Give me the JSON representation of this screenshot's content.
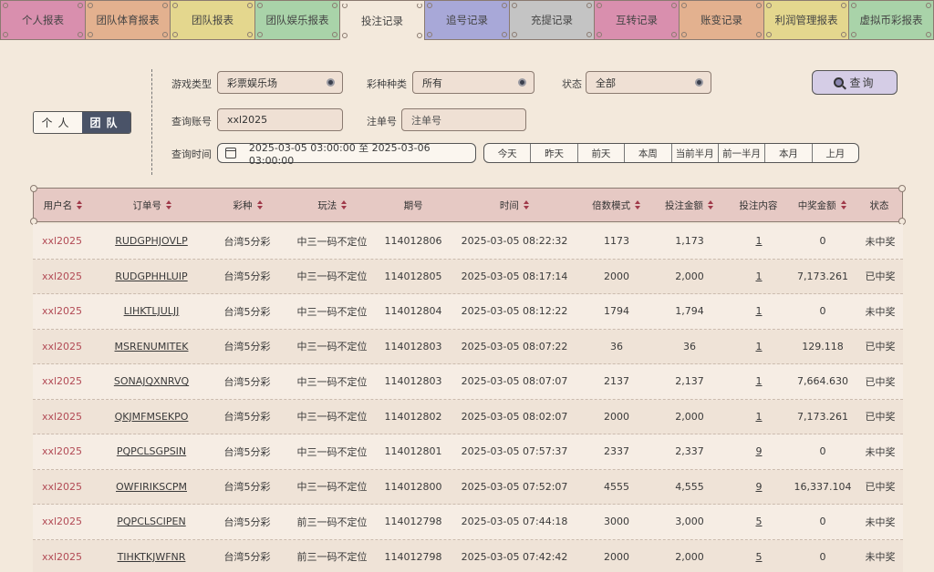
{
  "tabs": [
    {
      "label": "个人报表",
      "color": "#d98fae"
    },
    {
      "label": "团队体育报表",
      "color": "#e3b18f"
    },
    {
      "label": "团队报表",
      "color": "#e4d78e"
    },
    {
      "label": "团队娱乐报表",
      "color": "#a9d3a9"
    },
    {
      "label": "投注记录",
      "color": "#f3e9dc",
      "active": true
    },
    {
      "label": "追号记录",
      "color": "#a8a8d8"
    },
    {
      "label": "充提记录",
      "color": "#c4c4c4"
    },
    {
      "label": "互转记录",
      "color": "#d98fae"
    },
    {
      "label": "账变记录",
      "color": "#e3b18f"
    },
    {
      "label": "利润管理报表",
      "color": "#e4d78e"
    },
    {
      "label": "虚拟币彩报表",
      "color": "#a9d3a9"
    }
  ],
  "scope_toggle": {
    "personal": "个人",
    "team": "团队"
  },
  "filters": {
    "game_type_label": "游戏类型",
    "game_type_value": "彩票娱乐场",
    "lottery_kind_label": "彩种种类",
    "lottery_kind_value": "所有",
    "status_label": "状态",
    "status_value": "全部",
    "account_label": "查询账号",
    "account_value": "xxl2025",
    "order_label": "注单号",
    "order_placeholder": "注单号",
    "time_label": "查询时间",
    "time_range": "2025-03-05 03:00:00 至 2025-03-06 03:00:00",
    "search_button": "查询"
  },
  "quick_ranges": [
    "今天",
    "昨天",
    "前天",
    "本周",
    "当前半月",
    "前一半月",
    "本月",
    "上月"
  ],
  "table": {
    "headers": {
      "user": "用户名",
      "order": "订单号",
      "lottery": "彩种",
      "play": "玩法",
      "issue": "期号",
      "time": "时间",
      "mode": "倍数模式",
      "amount": "投注金额",
      "content": "投注内容",
      "win": "中奖金额",
      "status": "状态"
    },
    "rows": [
      {
        "user": "xxl2025",
        "order": "RUDGPHJOVLP",
        "lottery": "台湾5分彩",
        "play": "中三一码不定位",
        "issue": "114012806",
        "time": "2025-03-05 08:22:32",
        "mode": "1173",
        "amount": "1,173",
        "content": "1",
        "win": "0",
        "status": "未中奖"
      },
      {
        "user": "xxl2025",
        "order": "RUDGPHHLUIP",
        "lottery": "台湾5分彩",
        "play": "中三一码不定位",
        "issue": "114012805",
        "time": "2025-03-05 08:17:14",
        "mode": "2000",
        "amount": "2,000",
        "content": "1",
        "win": "7,173.261",
        "status": "已中奖"
      },
      {
        "user": "xxl2025",
        "order": "LIHKTLJULJJ",
        "lottery": "台湾5分彩",
        "play": "中三一码不定位",
        "issue": "114012804",
        "time": "2025-03-05 08:12:22",
        "mode": "1794",
        "amount": "1,794",
        "content": "1",
        "win": "0",
        "status": "未中奖"
      },
      {
        "user": "xxl2025",
        "order": "MSRENUMITEK",
        "lottery": "台湾5分彩",
        "play": "中三一码不定位",
        "issue": "114012803",
        "time": "2025-03-05 08:07:22",
        "mode": "36",
        "amount": "36",
        "content": "1",
        "win": "129.118",
        "status": "已中奖"
      },
      {
        "user": "xxl2025",
        "order": "SONAJQXNRVQ",
        "lottery": "台湾5分彩",
        "play": "中三一码不定位",
        "issue": "114012803",
        "time": "2025-03-05 08:07:07",
        "mode": "2137",
        "amount": "2,137",
        "content": "1",
        "win": "7,664.630",
        "status": "已中奖"
      },
      {
        "user": "xxl2025",
        "order": "QKJMFMSEKPO",
        "lottery": "台湾5分彩",
        "play": "中三一码不定位",
        "issue": "114012802",
        "time": "2025-03-05 08:02:07",
        "mode": "2000",
        "amount": "2,000",
        "content": "1",
        "win": "7,173.261",
        "status": "已中奖"
      },
      {
        "user": "xxl2025",
        "order": "PQPCLSGPSIN",
        "lottery": "台湾5分彩",
        "play": "中三一码不定位",
        "issue": "114012801",
        "time": "2025-03-05 07:57:37",
        "mode": "2337",
        "amount": "2,337",
        "content": "9",
        "win": "0",
        "status": "未中奖"
      },
      {
        "user": "xxl2025",
        "order": "OWFIRIKSCPM",
        "lottery": "台湾5分彩",
        "play": "中三一码不定位",
        "issue": "114012800",
        "time": "2025-03-05 07:52:07",
        "mode": "4555",
        "amount": "4,555",
        "content": "9",
        "win": "16,337.104",
        "status": "已中奖"
      },
      {
        "user": "xxl2025",
        "order": "PQPCLSCIPEN",
        "lottery": "台湾5分彩",
        "play": "前三一码不定位",
        "issue": "114012798",
        "time": "2025-03-05 07:44:18",
        "mode": "3000",
        "amount": "3,000",
        "content": "5",
        "win": "0",
        "status": "未中奖"
      },
      {
        "user": "xxl2025",
        "order": "TIHKTKJWFNR",
        "lottery": "台湾5分彩",
        "play": "前三一码不定位",
        "issue": "114012798",
        "time": "2025-03-05 07:42:42",
        "mode": "2000",
        "amount": "2,000",
        "content": "5",
        "win": "0",
        "status": "未中奖"
      }
    ]
  }
}
